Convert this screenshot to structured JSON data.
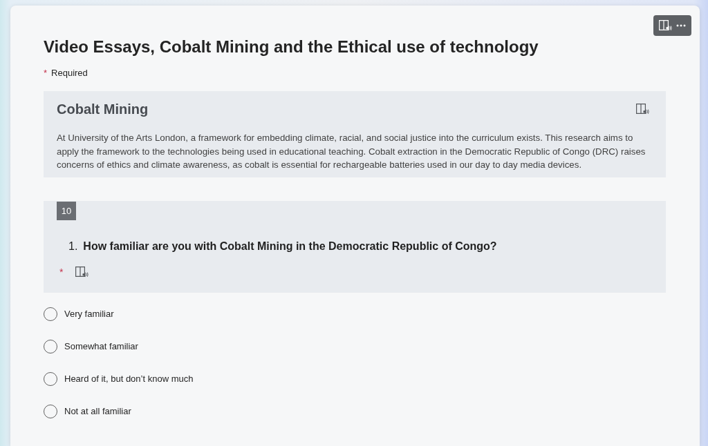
{
  "form": {
    "title": "Video Essays, Cobalt Mining and the Ethical use of technology",
    "required_mark": "*",
    "required_label": "Required"
  },
  "section": {
    "title": "Cobalt Mining",
    "description": "At University of the Arts London, a framework for embedding climate, racial, and social justice into the curriculum exists. This research aims to apply the framework to the technologies being used in educational teaching. Cobalt extraction in the Democratic Republic of Congo (DRC) raises concerns of ethics and climate awareness, as cobalt is essential for rechargeable batteries used in our day to day media devices."
  },
  "question": {
    "tag": "10",
    "number": "1.",
    "text": "How familiar are you with Cobalt Mining in the Democratic Republic of Congo?",
    "required_mark": "*",
    "options": [
      {
        "label": "Very familiar",
        "selected": false
      },
      {
        "label": "Somewhat familiar",
        "selected": false
      },
      {
        "label": "Heard of it, but don’t know much",
        "selected": false
      },
      {
        "label": "Not at all familiar",
        "selected": false
      }
    ]
  }
}
